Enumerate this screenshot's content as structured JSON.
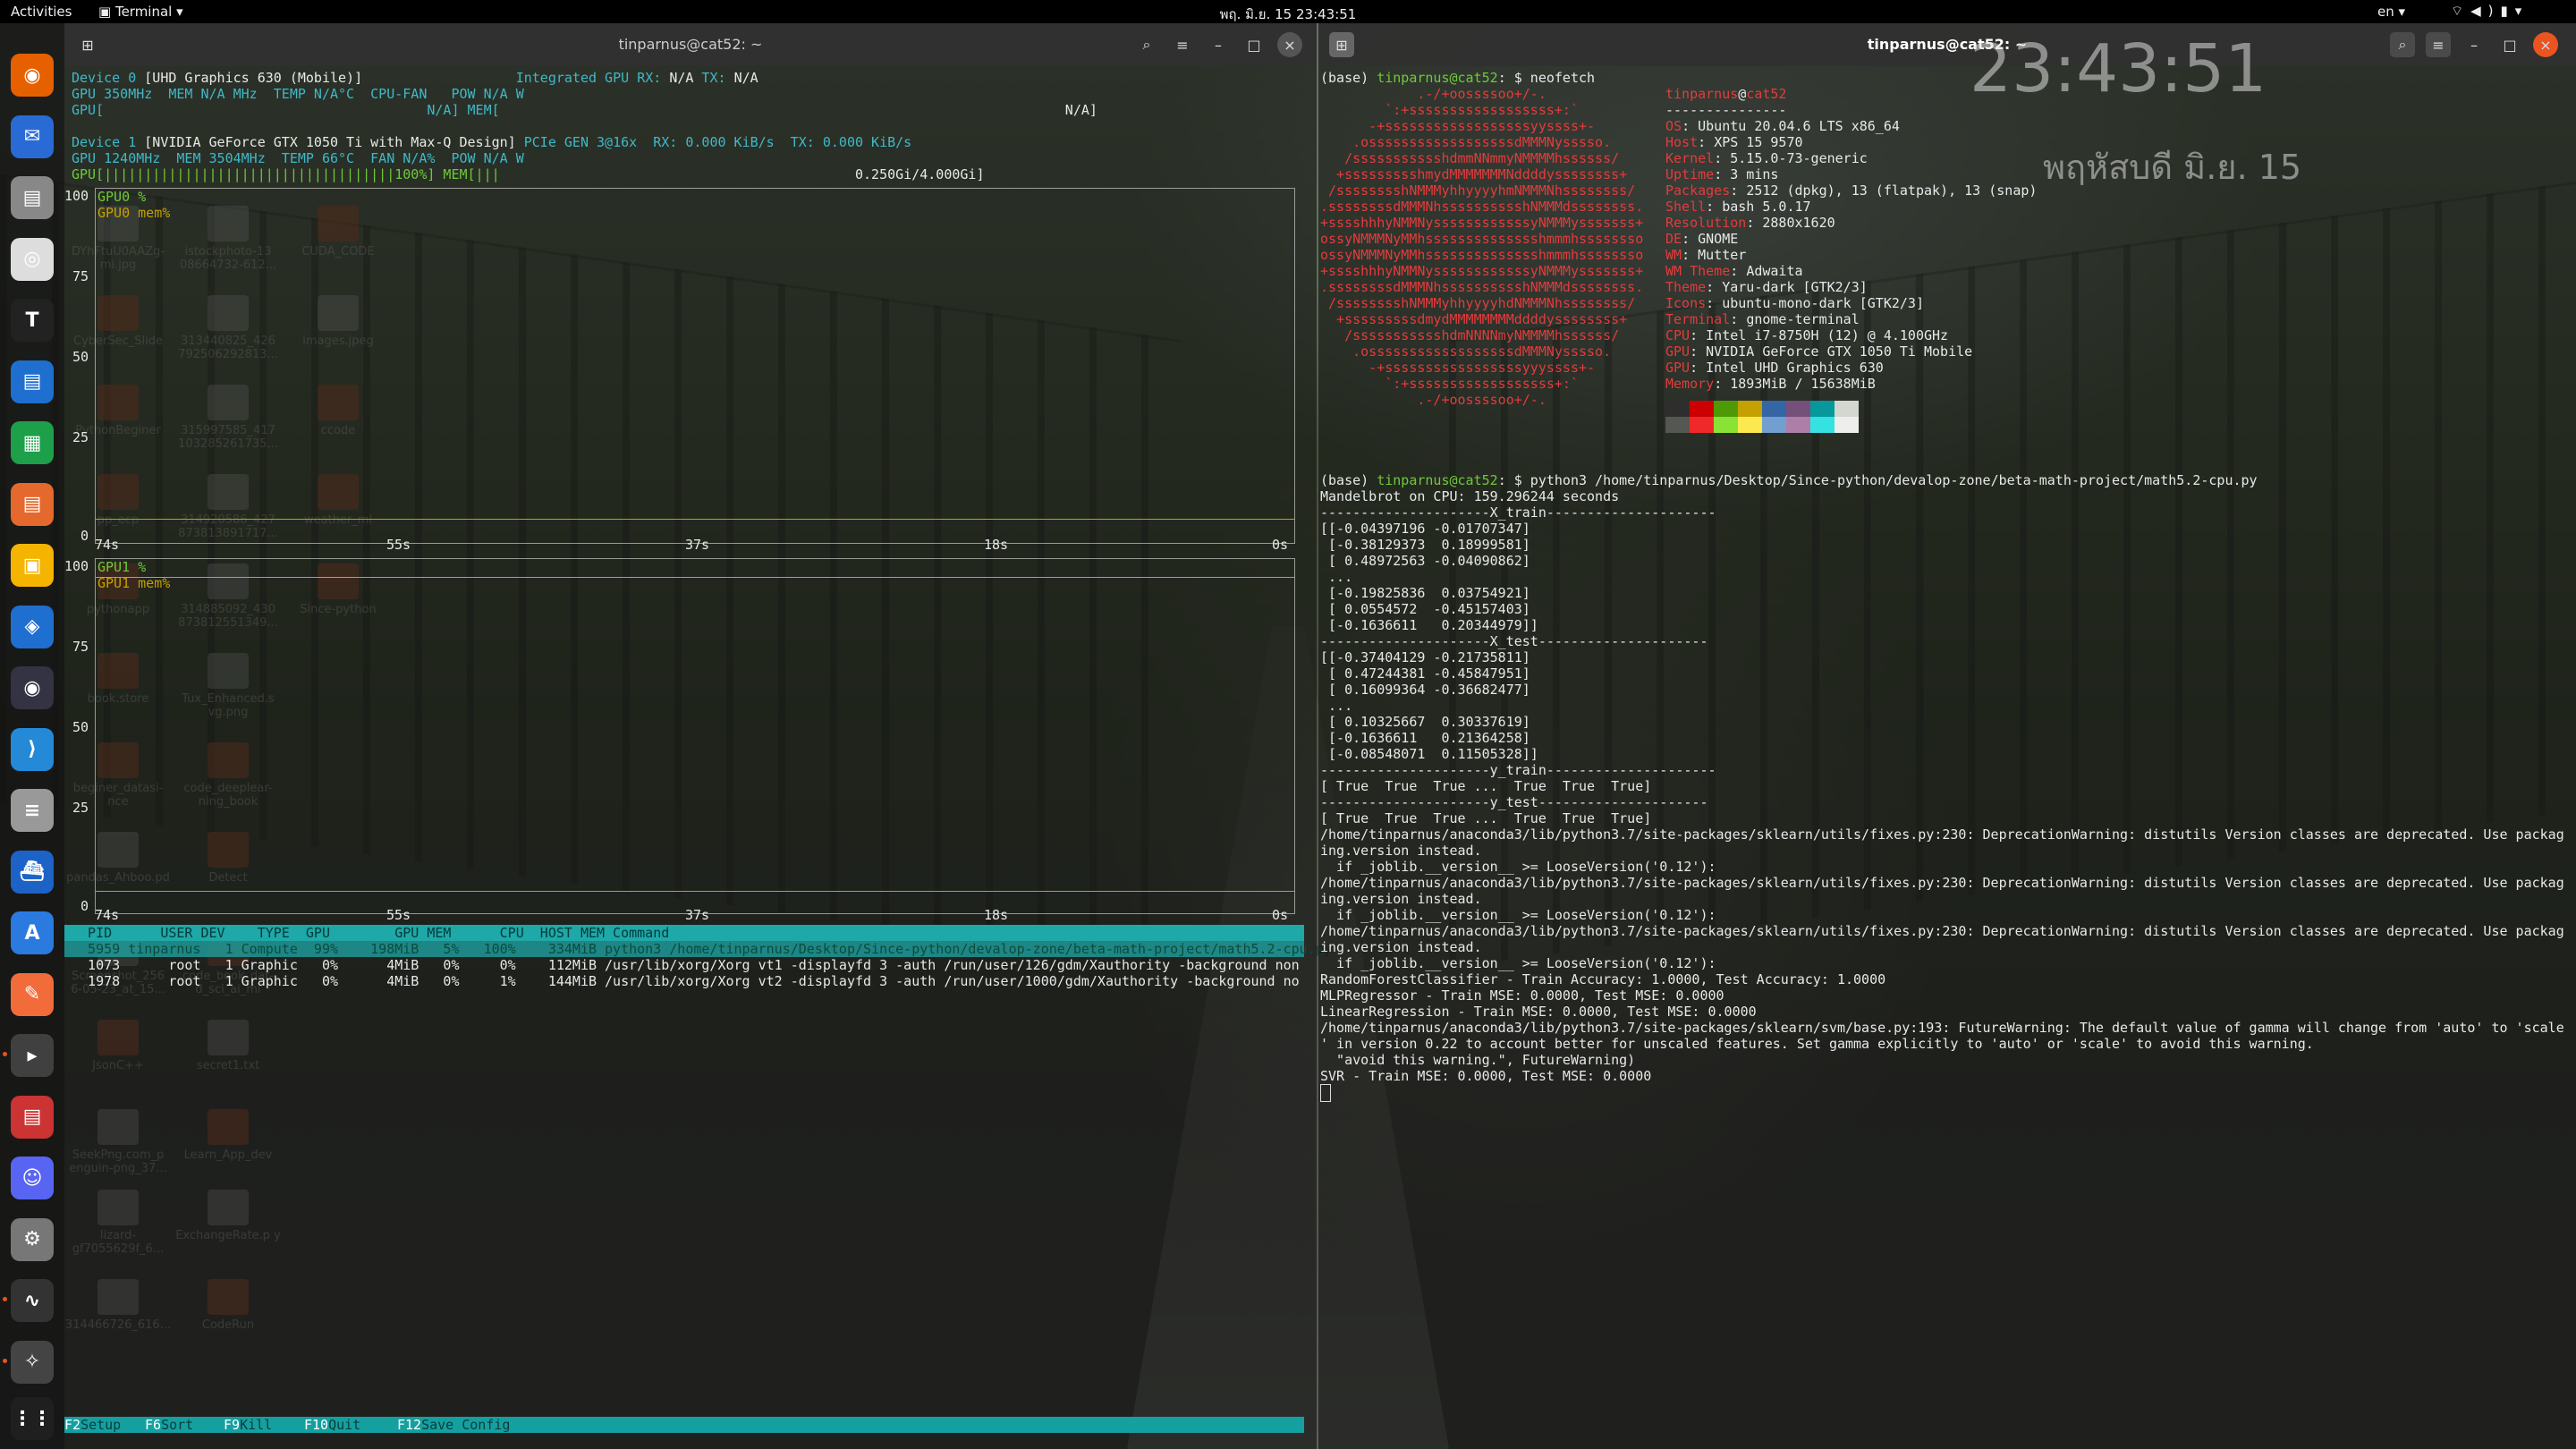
{
  "topbar": {
    "activities": "Activities",
    "app_name": "Terminal",
    "clock": "พฤ. มิ.ย. 15  23:43:51",
    "lang": "en"
  },
  "dock": {
    "apps": [
      "firefox-icon",
      "thunderbird-icon",
      "files-icon",
      "rhythmbox-icon",
      "typora-icon",
      "writer-icon",
      "calc-icon",
      "impress-icon",
      "image-viewer-icon",
      "software-icon",
      "obs-icon",
      "vscode-icon",
      "database-icon",
      "docker-icon",
      "android-studio-icon",
      "postman-icon",
      "terminal-icon",
      "document-viewer-icon",
      "discord-icon",
      "settings-icon",
      "system-monitor-icon",
      "inkscape-icon",
      "show-apps-icon"
    ]
  },
  "desktop_icons": [
    {
      "label": "DYhFtuU0AAZg- mi.jpg"
    },
    {
      "label": "istockphoto-13 08664732-612..."
    },
    {
      "label": "CUDA_CODE"
    },
    {
      "label": "CyberSec_Slide"
    },
    {
      "label": "313440825_426 792506292813..."
    },
    {
      "label": "images.jpeg"
    },
    {
      "label": "PythonBeginer"
    },
    {
      "label": "315997585_417 103285261735..."
    },
    {
      "label": "ccode"
    },
    {
      "label": "pp_ecp"
    },
    {
      "label": "314920586_427 873813891717..."
    },
    {
      "label": "weather_ml"
    },
    {
      "label": "pythonapp"
    },
    {
      "label": "314885092_430 873812551349..."
    },
    {
      "label": "Since-python"
    },
    {
      "label": "book.store"
    },
    {
      "label": "Tux_Enhanced.s vg.png"
    },
    {
      "label": "beginer_datasi- nce"
    },
    {
      "label": "code_deeplear- ning_book"
    },
    {
      "label": "pandas_Ahboo.pd"
    },
    {
      "label": "Detect"
    },
    {
      "label": "Screenshot_256 6-05-23_at_15..."
    },
    {
      "label": "code_book_dat- d_sci_ai_ml"
    },
    {
      "label": "JsonC++"
    },
    {
      "label": "secret1.txt"
    },
    {
      "label": "SeekPng.com_p enguin-png_37..."
    },
    {
      "label": "Learn_App_dev"
    },
    {
      "label": "lizard- gf7055629f_6..."
    },
    {
      "label": "ExchangeRate.p y"
    },
    {
      "label": "314466726_616..."
    },
    {
      "label": "CodeRun"
    }
  ],
  "left_terminal": {
    "title": "tinparnus@cat52: ~",
    "device0": {
      "line1_a": "Device 0 ",
      "line1_b": "[UHD Graphics 630 (Mobile)]",
      "line1_c": "Integrated GPU ",
      "line1_d": "RX: ",
      "line1_e": "N/A",
      "line1_f": " TX: ",
      "line1_g": "N/A",
      "line2": "GPU 350MHz  MEM N/A MHz  TEMP N/A°C  CPU-FAN   POW N/A W",
      "line3a": "GPU[",
      "line3b": "N/A] MEM[",
      "line3c": "N/A]"
    },
    "device1": {
      "line1_a": "Device 1 ",
      "line1_b": "[NVIDIA GeForce GTX 1050 Ti with Max-Q Design]",
      "line1_c": " PCIe GEN 3@16x  RX: 0.000 KiB/s  TX: 0.000 KiB/s",
      "line2": "GPU 1240MHz  MEM 3504MHz  TEMP 66°C  FAN N/A%  POW N/A W",
      "line3a": "GPU[||||||||||||||||||||||||||||||||||||100%] MEM[|||",
      "line3b": "0.250Gi/4.000Gi]"
    },
    "graph0": {
      "legend1": "GPU0 %",
      "legend2": "GPU0 mem%"
    },
    "graph1": {
      "legend1": "GPU1 %",
      "legend2": "GPU1 mem%"
    },
    "y_ticks": [
      "100",
      "75",
      "50",
      "25",
      "0"
    ],
    "x_ticks": [
      "74s",
      "55s",
      "37s",
      "18s",
      "0s"
    ],
    "proc_header": "  PID      USER DEV    TYPE  GPU        GPU MEM      CPU  HOST MEM Command",
    "processes": [
      "  5959 tinparnus   1 Compute  99%    198MiB   5%   100%    334MiB python3 /home/tinparnus/Desktop/Since-python/devalop-zone/beta-math-project/math5.2-cpu.py",
      "  1073      root   1 Graphic   0%      4MiB   0%     0%    112MiB /usr/lib/xorg/Xorg vt1 -displayfd 3 -auth /run/user/126/gdm/Xauthority -background non",
      "  1978      root   1 Graphic   0%      4MiB   0%     1%    144MiB /usr/lib/xorg/Xorg vt2 -displayfd 3 -auth /run/user/1000/gdm/Xauthority -background no"
    ],
    "fkeys": [
      {
        "key": "F2",
        "label": "Setup"
      },
      {
        "key": "F6",
        "label": "Sort"
      },
      {
        "key": "F9",
        "label": "Kill"
      },
      {
        "key": "F10",
        "label": "Quit"
      },
      {
        "key": "F12",
        "label": "Save Config"
      }
    ]
  },
  "right_terminal": {
    "title": "tinparnus@cat52: ~",
    "prompt1_env": "(base) ",
    "prompt1_user": "tinparnus@cat52",
    "prompt1_cmd": ": $ neofetch",
    "ascii_art": [
      "            .-/+oossssoo+/-.",
      "        `:+ssssssssssssssssss+:`",
      "      -+ssssssssssssssssssyyssss+-",
      "    .ossssssssssssssssssdMMMNysssso.",
      "   /ssssssssssshdmmNNmmyNMMMMhssssss/",
      "  +ssssssssshmydMMMMMMMNddddyssssssss+",
      " /sssssssshNMMMyhhyyyyhmNMMMNhssssssss/",
      ".ssssssssdMMMNhsssssssssshNMMMdssssssss.",
      "+sssshhhyNMMNyssssssssssssyNMMMysssssss+",
      "ossyNMMMNyMMhsssssssssssssshmmmhssssssso",
      "ossyNMMMNyMMhsssssssssssssshmmmhssssssso",
      "+sssshhhyNMMNyssssssssssssyNMMMysssssss+",
      ".ssssssssdMMMNhsssssssssshNMMMdssssssss.",
      " /sssssssshNMMMyhhyyyyhdNMMMNhssssssss/",
      "  +sssssssssdmydMMMMMMMMddddyssssssss+",
      "   /ssssssssssshdmNNNNmyNMMMMhssssss/",
      "    .ossssssssssssssssssdMMMNysssso.",
      "      -+sssssssssssssssssyyyssss+-",
      "        `:+ssssssssssssssssss+:`",
      "            .-/+oossssoo+/-."
    ],
    "info_user": "tinparnus",
    "info_at": "@",
    "info_host": "cat52",
    "info_sep": "---------------",
    "info": [
      {
        "k": "OS",
        "v": "Ubuntu 20.04.6 LTS x86_64"
      },
      {
        "k": "Host",
        "v": "XPS 15 9570"
      },
      {
        "k": "Kernel",
        "v": "5.15.0-73-generic"
      },
      {
        "k": "Uptime",
        "v": "3 mins"
      },
      {
        "k": "Packages",
        "v": "2512 (dpkg), 13 (flatpak), 13 (snap)"
      },
      {
        "k": "Shell",
        "v": "bash 5.0.17"
      },
      {
        "k": "Resolution",
        "v": "2880x1620"
      },
      {
        "k": "DE",
        "v": "GNOME"
      },
      {
        "k": "WM",
        "v": "Mutter"
      },
      {
        "k": "WM Theme",
        "v": "Adwaita"
      },
      {
        "k": "Theme",
        "v": "Yaru-dark [GTK2/3]"
      },
      {
        "k": "Icons",
        "v": "ubuntu-mono-dark [GTK2/3]"
      },
      {
        "k": "Terminal",
        "v": "gnome-terminal"
      },
      {
        "k": "CPU",
        "v": "Intel i7-8750H (12) @ 4.100GHz"
      },
      {
        "k": "GPU",
        "v": "NVIDIA GeForce GTX 1050 Ti Mobile"
      },
      {
        "k": "GPU",
        "v": "Intel UHD Graphics 630"
      },
      {
        "k": "Memory",
        "v": "1893MiB / 15638MiB"
      }
    ],
    "palette": [
      "#2e2e2e",
      "#cc0000",
      "#4e9a06",
      "#c4a000",
      "#3465a4",
      "#75507b",
      "#06989a",
      "#d3d7cf",
      "#555753",
      "#ef2929",
      "#8ae234",
      "#fce94f",
      "#729fcf",
      "#ad7fa8",
      "#34e2e2",
      "#eeeeec"
    ],
    "prompt2_env": "(base) ",
    "prompt2_user": "tinparnus@cat52",
    "prompt2_cmd": ": $ python3 /home/tinparnus/Desktop/Since-python/devalop-zone/beta-math-project/math5.2-cpu.py",
    "output": [
      "Mandelbrot on CPU: 159.296244 seconds",
      "---------------------X_train---------------------",
      "[[-0.04397196 -0.01707347]",
      " [-0.38129373  0.18999581]",
      " [ 0.48972563 -0.04090862]",
      " ...",
      " [-0.19825836  0.03754921]",
      " [ 0.0554572  -0.45157403]",
      " [-0.1636611   0.20344979]]",
      "---------------------X_test---------------------",
      "[[-0.37404129 -0.21735811]",
      " [ 0.47244381 -0.45847951]",
      " [ 0.16099364 -0.36682477]",
      " ...",
      " [ 0.10325667  0.30337619]",
      " [-0.1636611   0.21364258]",
      " [-0.08548071  0.11505328]]",
      "---------------------y_train---------------------",
      "[ True  True  True ...  True  True  True]",
      "---------------------y_test---------------------",
      "[ True  True  True ...  True  True  True]",
      "/home/tinparnus/anaconda3/lib/python3.7/site-packages/sklearn/utils/fixes.py:230: DeprecationWarning: distutils Version classes are deprecated. Use packag",
      "ing.version instead.",
      "  if _joblib.__version__ >= LooseVersion('0.12'):",
      "/home/tinparnus/anaconda3/lib/python3.7/site-packages/sklearn/utils/fixes.py:230: DeprecationWarning: distutils Version classes are deprecated. Use packag",
      "ing.version instead.",
      "  if _joblib.__version__ >= LooseVersion('0.12'):",
      "/home/tinparnus/anaconda3/lib/python3.7/site-packages/sklearn/utils/fixes.py:230: DeprecationWarning: distutils Version classes are deprecated. Use packag",
      "ing.version instead.",
      "  if _joblib.__version__ >= LooseVersion('0.12'):",
      "RandomForestClassifier - Train Accuracy: 1.0000, Test Accuracy: 1.0000",
      "MLPRegressor - Train MSE: 0.0000, Test MSE: 0.0000",
      "LinearRegression - Train MSE: 0.0000, Test MSE: 0.0000",
      "/home/tinparnus/anaconda3/lib/python3.7/site-packages/sklearn/svm/base.py:193: FutureWarning: The default value of gamma will change from 'auto' to 'scale",
      "' in version 0.22 to account better for unscaled features. Set gamma explicitly to 'auto' or 'scale' to avoid this warning.",
      "  \"avoid this warning.\", FutureWarning)",
      "SVR - Train MSE: 0.0000, Test MSE: 0.0000"
    ],
    "big_clock": "23:43:51",
    "big_date": "พฤหัสบดี มิ.ย. 15"
  }
}
